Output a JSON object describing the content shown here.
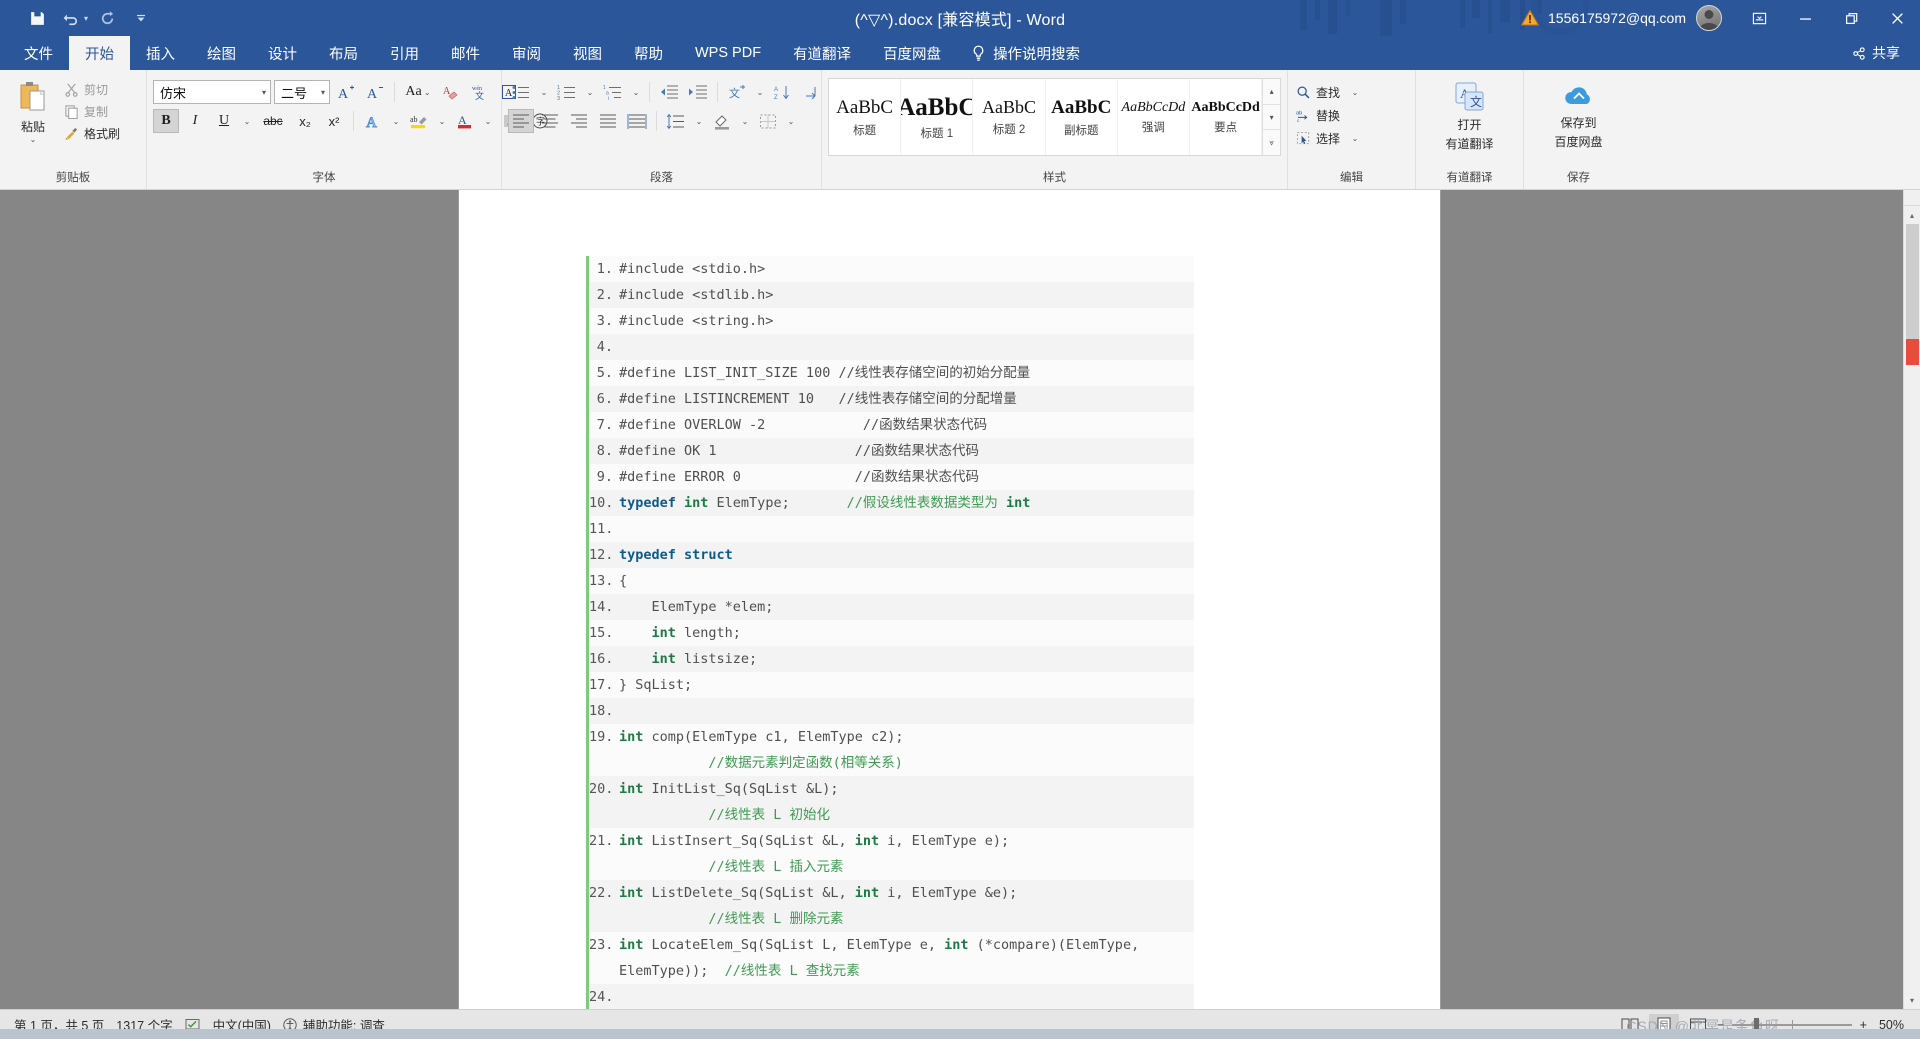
{
  "titlebar": {
    "quick_access": [
      {
        "name": "save-icon",
        "label": "保存"
      },
      {
        "name": "undo-icon",
        "label": "撤消"
      },
      {
        "name": "redo-icon",
        "label": "恢复"
      },
      {
        "name": "customize-qat-icon",
        "label": "自定义快速访问工具栏"
      }
    ],
    "document_title": "(^▽^).docx [兼容模式]  -  Word",
    "account_name": "1556175972@qq.com",
    "warning_icon": "warning-triangle-icon",
    "window_controls": [
      {
        "name": "ribbon-display-options",
        "glyph": "▭"
      },
      {
        "name": "minimize",
        "glyph": "—"
      },
      {
        "name": "restore",
        "glyph": "❐"
      },
      {
        "name": "close",
        "glyph": "✕"
      }
    ]
  },
  "tabs": [
    {
      "label": "文件",
      "active": false
    },
    {
      "label": "开始",
      "active": true
    },
    {
      "label": "插入",
      "active": false
    },
    {
      "label": "绘图",
      "active": false
    },
    {
      "label": "设计",
      "active": false
    },
    {
      "label": "布局",
      "active": false
    },
    {
      "label": "引用",
      "active": false
    },
    {
      "label": "邮件",
      "active": false
    },
    {
      "label": "审阅",
      "active": false
    },
    {
      "label": "视图",
      "active": false
    },
    {
      "label": "帮助",
      "active": false
    },
    {
      "label": "WPS PDF",
      "active": false
    },
    {
      "label": "有道翻译",
      "active": false
    },
    {
      "label": "百度网盘",
      "active": false
    }
  ],
  "tell_me": "操作说明搜索",
  "share_label": "共享",
  "ribbon": {
    "clipboard": {
      "label": "剪贴板",
      "paste": "粘贴",
      "cut": "剪切",
      "copy": "复制",
      "format_painter": "格式刷"
    },
    "font": {
      "label": "字体",
      "font_name": "仿宋",
      "font_size": "二号",
      "grow_font": "增大字号",
      "shrink_font": "减小字号",
      "change_case": "Aa",
      "clear_formatting": "清除所有格式",
      "phonetic_guide": "拼音指南",
      "char_border": "字符边框",
      "bold": "B",
      "italic": "I",
      "underline": "U",
      "strikethrough": "abc",
      "subscript": "x₂",
      "superscript": "x²",
      "text_effects": "文本效果",
      "highlight": "文本突出显示颜色",
      "font_color": "字体颜色",
      "char_shading": "字符底纹",
      "enclose_char": "带圈字符"
    },
    "paragraph": {
      "label": "段落",
      "bullets": "项目符号",
      "numbering": "编号",
      "multilevel": "多级列表",
      "decrease_indent": "减少缩进量",
      "increase_indent": "增加缩进量",
      "cn_layout": "中文版式",
      "sort": "排序",
      "show_marks": "显示/隐藏编辑标记",
      "align_left": "左对齐",
      "align_center": "居中",
      "align_right": "右对齐",
      "justify": "两端对齐",
      "distribute": "分散对齐",
      "line_spacing": "行和段落间距",
      "shading": "底纹",
      "borders": "边框"
    },
    "styles": {
      "label": "样式",
      "items": [
        {
          "preview": "AaBbC",
          "name": "标题",
          "size": "19px",
          "weight": "normal",
          "style": "normal"
        },
        {
          "preview": "AaBbC",
          "name": "标题 1",
          "size": "24px",
          "weight": "bold",
          "style": "normal"
        },
        {
          "preview": "AaBbC",
          "name": "标题 2",
          "size": "18px",
          "weight": "normal",
          "style": "normal"
        },
        {
          "preview": "AaBbC",
          "name": "副标题",
          "size": "19px",
          "weight": "bold",
          "style": "normal"
        },
        {
          "preview": "AaBbCcDd",
          "name": "强调",
          "size": "14px",
          "weight": "normal",
          "style": "italic"
        },
        {
          "preview": "AaBbCcDd",
          "name": "要点",
          "size": "14px",
          "weight": "bold",
          "style": "normal"
        }
      ]
    },
    "editing": {
      "label": "编辑",
      "find": "查找",
      "replace": "替换",
      "select": "选择"
    },
    "youdao": {
      "label": "有道翻译",
      "button_line1": "打开",
      "button_line2": "有道翻译"
    },
    "baidu": {
      "label": "保存",
      "button_line1": "保存到",
      "button_line2": "百度网盘"
    }
  },
  "document": {
    "code_lines": [
      {
        "n": "1.",
        "tokens": [
          {
            "t": "#include <stdio.h>",
            "c": "pl"
          }
        ]
      },
      {
        "n": "2.",
        "tokens": [
          {
            "t": "#include <stdlib.h>",
            "c": "pl"
          }
        ]
      },
      {
        "n": "3.",
        "tokens": [
          {
            "t": "#include <string.h>",
            "c": "pl"
          }
        ]
      },
      {
        "n": "4.",
        "tokens": [
          {
            "t": "",
            "c": "pl"
          }
        ]
      },
      {
        "n": "5.",
        "tokens": [
          {
            "t": "#define LIST_INIT_SIZE 100 ",
            "c": "pl"
          },
          {
            "t": "//线性表存储空间的初始分配量",
            "c": "pl"
          }
        ]
      },
      {
        "n": "6.",
        "tokens": [
          {
            "t": "#define LISTINCREMENT 10   ",
            "c": "pl"
          },
          {
            "t": "//线性表存储空间的分配增量",
            "c": "pl"
          }
        ]
      },
      {
        "n": "7.",
        "tokens": [
          {
            "t": "#define OVERLOW -2            ",
            "c": "pl"
          },
          {
            "t": "//函数结果状态代码",
            "c": "pl"
          }
        ]
      },
      {
        "n": "8.",
        "tokens": [
          {
            "t": "#define OK 1                 ",
            "c": "pl"
          },
          {
            "t": "//函数结果状态代码",
            "c": "pl"
          }
        ]
      },
      {
        "n": "9.",
        "tokens": [
          {
            "t": "#define ERROR 0              ",
            "c": "pl"
          },
          {
            "t": "//函数结果状态代码",
            "c": "pl"
          }
        ]
      },
      {
        "n": "10.",
        "tokens": [
          {
            "t": "typedef ",
            "c": "kw"
          },
          {
            "t": "int ",
            "c": "ty"
          },
          {
            "t": "ElemType;       ",
            "c": "pl"
          },
          {
            "t": "//假设线性表数据类型为 ",
            "c": "cm"
          },
          {
            "t": "int",
            "c": "ty"
          }
        ]
      },
      {
        "n": "11.",
        "tokens": [
          {
            "t": "",
            "c": "pl"
          }
        ]
      },
      {
        "n": "12.",
        "tokens": [
          {
            "t": "typedef struct",
            "c": "kw"
          }
        ]
      },
      {
        "n": "13.",
        "tokens": [
          {
            "t": "{",
            "c": "pl"
          }
        ]
      },
      {
        "n": "14.",
        "tokens": [
          {
            "t": "    ElemType *elem;",
            "c": "pl"
          }
        ]
      },
      {
        "n": "15.",
        "tokens": [
          {
            "t": "    ",
            "c": "pl"
          },
          {
            "t": "int ",
            "c": "ty"
          },
          {
            "t": "length;",
            "c": "pl"
          }
        ]
      },
      {
        "n": "16.",
        "tokens": [
          {
            "t": "    ",
            "c": "pl"
          },
          {
            "t": "int ",
            "c": "ty"
          },
          {
            "t": "listsize;",
            "c": "pl"
          }
        ]
      },
      {
        "n": "17.",
        "tokens": [
          {
            "t": "} SqList;",
            "c": "pl"
          }
        ]
      },
      {
        "n": "18.",
        "tokens": [
          {
            "t": "",
            "c": "pl"
          }
        ]
      },
      {
        "n": "19.",
        "tokens": [
          {
            "t": "int ",
            "c": "ty"
          },
          {
            "t": "comp(ElemType c1, ElemType c2);",
            "c": "pl"
          },
          {
            "t": "\n           //数据元素判定函数(相等关系)",
            "c": "cm"
          }
        ]
      },
      {
        "n": "20.",
        "tokens": [
          {
            "t": "int ",
            "c": "ty"
          },
          {
            "t": "InitList_Sq(SqList &L);",
            "c": "pl"
          },
          {
            "t": "\n           //线性表 L 初始化",
            "c": "cm"
          }
        ]
      },
      {
        "n": "21.",
        "tokens": [
          {
            "t": "int ",
            "c": "ty"
          },
          {
            "t": "ListInsert_Sq(SqList &L, ",
            "c": "pl"
          },
          {
            "t": "int ",
            "c": "ty"
          },
          {
            "t": "i, ElemType e);",
            "c": "pl"
          },
          {
            "t": "\n           //线性表 L 插入元素",
            "c": "cm"
          }
        ]
      },
      {
        "n": "22.",
        "tokens": [
          {
            "t": "int ",
            "c": "ty"
          },
          {
            "t": "ListDelete_Sq(SqList &L, ",
            "c": "pl"
          },
          {
            "t": "int ",
            "c": "ty"
          },
          {
            "t": "i, ElemType &e);",
            "c": "pl"
          },
          {
            "t": "\n           //线性表 L 删除元素",
            "c": "cm"
          }
        ]
      },
      {
        "n": "23.",
        "tokens": [
          {
            "t": "int ",
            "c": "ty"
          },
          {
            "t": "LocateElem_Sq(SqList L, ElemType e, ",
            "c": "pl"
          },
          {
            "t": "int ",
            "c": "ty"
          },
          {
            "t": "(*compare)(ElemType, ElemType));  ",
            "c": "pl"
          },
          {
            "t": "//线性表 L 查找元素",
            "c": "cm"
          }
        ]
      },
      {
        "n": "24.",
        "tokens": [
          {
            "t": "",
            "c": "pl"
          }
        ]
      }
    ]
  },
  "statusbar": {
    "page_info": "第 1 页，共 5 页",
    "word_count": "1317 个字",
    "proofing_icon": "spelling-check-icon",
    "language": "中文(中国)",
    "accessibility": "辅助功能: 调查",
    "views": [
      {
        "name": "read-mode-view-button",
        "active": false
      },
      {
        "name": "print-layout-view-button",
        "active": true
      },
      {
        "name": "web-layout-view-button",
        "active": false
      }
    ],
    "zoom_level": "50%",
    "watermark": "CSDN @北冥是条鱼呀"
  },
  "colors": {
    "brand_blue": "#2b579a",
    "ribbon_bg": "#f3f3f3",
    "code_accent": "#7ecb7e",
    "keyword": "#0d5a8c",
    "type": "#1f7a46",
    "comment": "#3f9b53"
  }
}
